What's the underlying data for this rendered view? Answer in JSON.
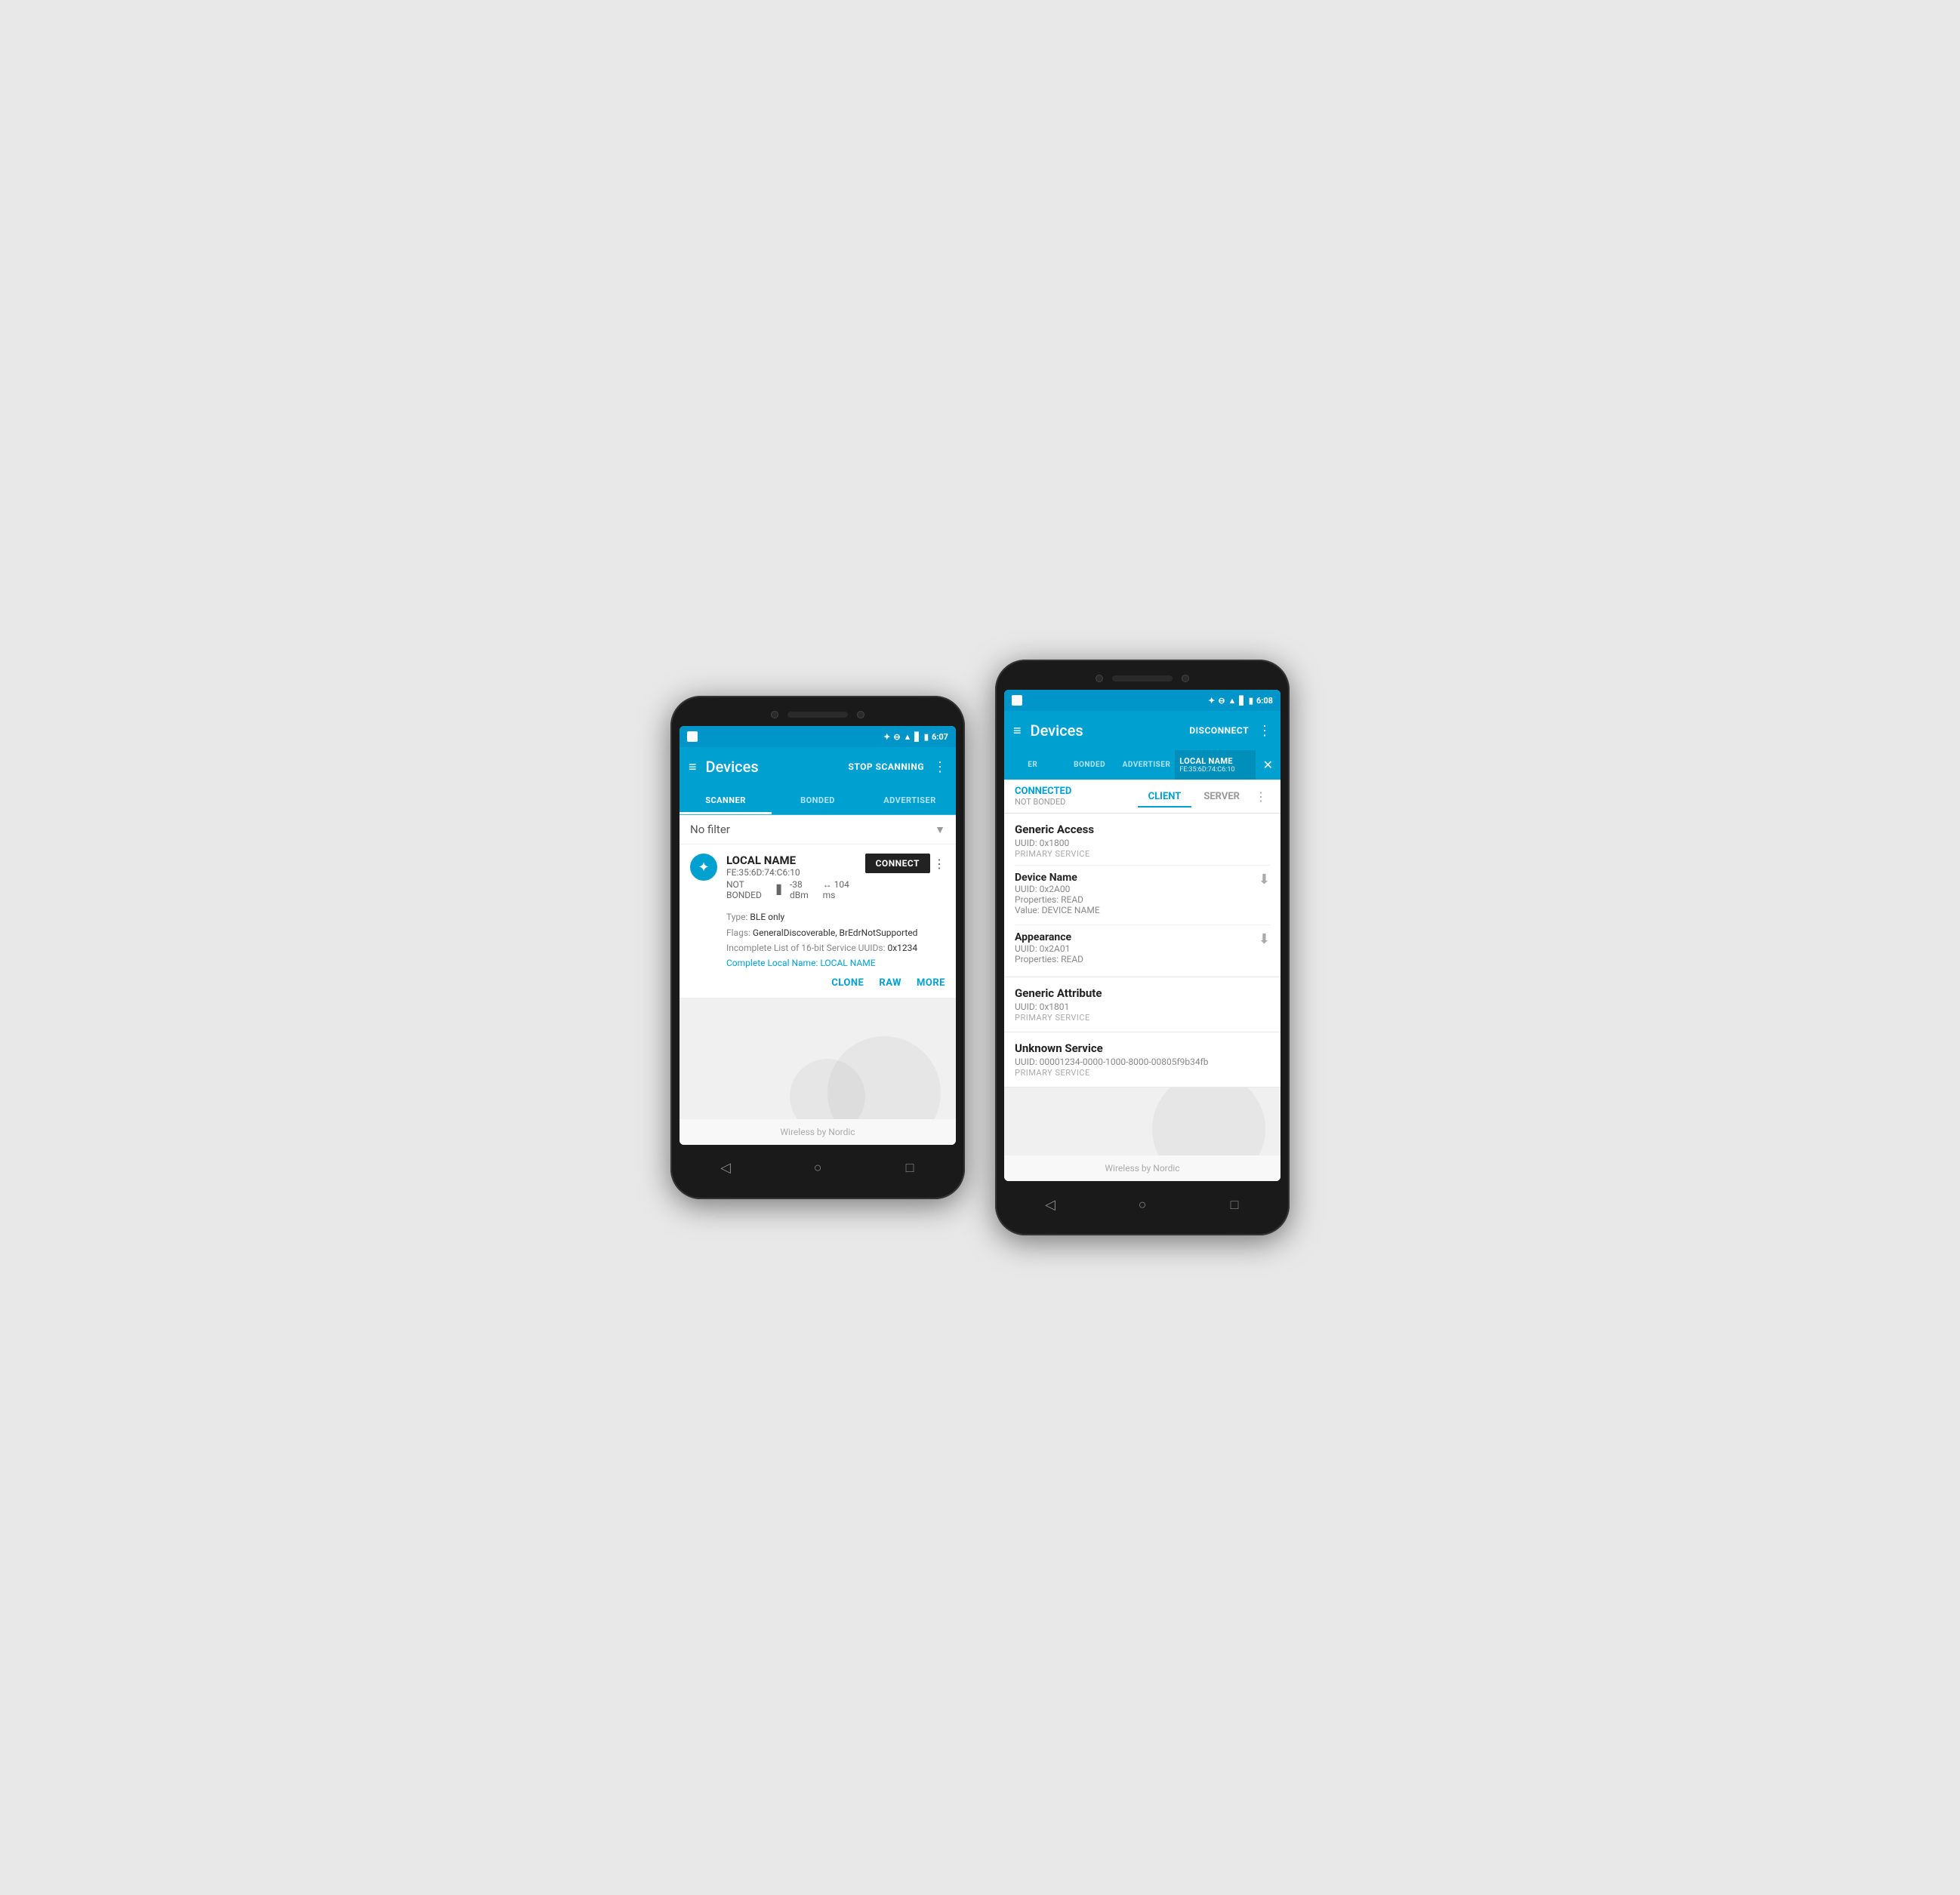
{
  "phone1": {
    "statusBar": {
      "time": "6:07",
      "icons": [
        "bluetooth",
        "minus-circle",
        "wifi",
        "signal",
        "battery"
      ]
    },
    "appBar": {
      "title": "Devices",
      "action": "STOP SCANNING",
      "hamburger": "≡",
      "more": "⋮"
    },
    "tabs": [
      {
        "label": "SCANNER",
        "active": true
      },
      {
        "label": "BONDED",
        "active": false
      },
      {
        "label": "ADVERTISER",
        "active": false
      }
    ],
    "filter": {
      "text": "No filter",
      "arrow": "▼"
    },
    "device": {
      "name": "LOCAL NAME",
      "mac": "FE:35:6D:74:C6:10",
      "bonded": "NOT BONDED",
      "rssi": "-38 dBm",
      "interval": "↔ 104 ms",
      "connectBtn": "CONNECT",
      "moreBtn": "⋮",
      "details": [
        {
          "label": "Type:",
          "value": "BLE only"
        },
        {
          "label": "Flags:",
          "value": "GeneralDiscoverable, BrEdrNotSupported"
        },
        {
          "label": "Incomplete List of 16-bit Service UUIDs:",
          "value": "0x1234"
        },
        {
          "label": "Complete Local Name:",
          "value": "LOCAL NAME",
          "colored": true
        }
      ],
      "actions": [
        "CLONE",
        "RAW",
        "MORE"
      ]
    },
    "footer": "Wireless by Nordic",
    "navButtons": [
      "◁",
      "○",
      "□"
    ]
  },
  "phone2": {
    "statusBar": {
      "time": "6:08",
      "icons": [
        "bluetooth",
        "minus-circle",
        "wifi",
        "signal",
        "battery"
      ]
    },
    "appBar": {
      "title": "Devices",
      "action": "DISCONNECT",
      "hamburger": "≡",
      "more": "⋮"
    },
    "tabs": [
      {
        "label": "ER",
        "active": false
      },
      {
        "label": "BONDED",
        "active": false
      },
      {
        "label": "ADVERTISER",
        "active": false
      }
    ],
    "localNameTab": {
      "label": "LOCAL NAME",
      "mac": "FE:35:6D:74:C6:10",
      "closeBtn": "✕"
    },
    "connectedBar": {
      "connectedLabel": "CONNECTED",
      "bondedLabel": "NOT BONDED",
      "clientTab": "CLIENT",
      "serverTab": "SERVER",
      "moreBtn": "⋮"
    },
    "services": [
      {
        "name": "Generic Access",
        "uuid": "UUID: 0x1800",
        "type": "PRIMARY SERVICE",
        "characteristics": [
          {
            "name": "Device Name",
            "uuid": "UUID: 0x2A00",
            "properties": "Properties: READ",
            "value": "Value: DEVICE NAME",
            "hasDownload": true
          },
          {
            "name": "Appearance",
            "uuid": "UUID: 0x2A01",
            "properties": "Properties: READ",
            "value": null,
            "hasDownload": true
          }
        ]
      },
      {
        "name": "Generic Attribute",
        "uuid": "UUID: 0x1801",
        "type": "PRIMARY SERVICE",
        "characteristics": []
      },
      {
        "name": "Unknown Service",
        "uuid": "UUID: 00001234-0000-1000-8000-00805f9b34fb",
        "type": "PRIMARY SERVICE",
        "characteristics": []
      }
    ],
    "footer": "Wireless by Nordic",
    "navButtons": [
      "◁",
      "○",
      "□"
    ]
  }
}
